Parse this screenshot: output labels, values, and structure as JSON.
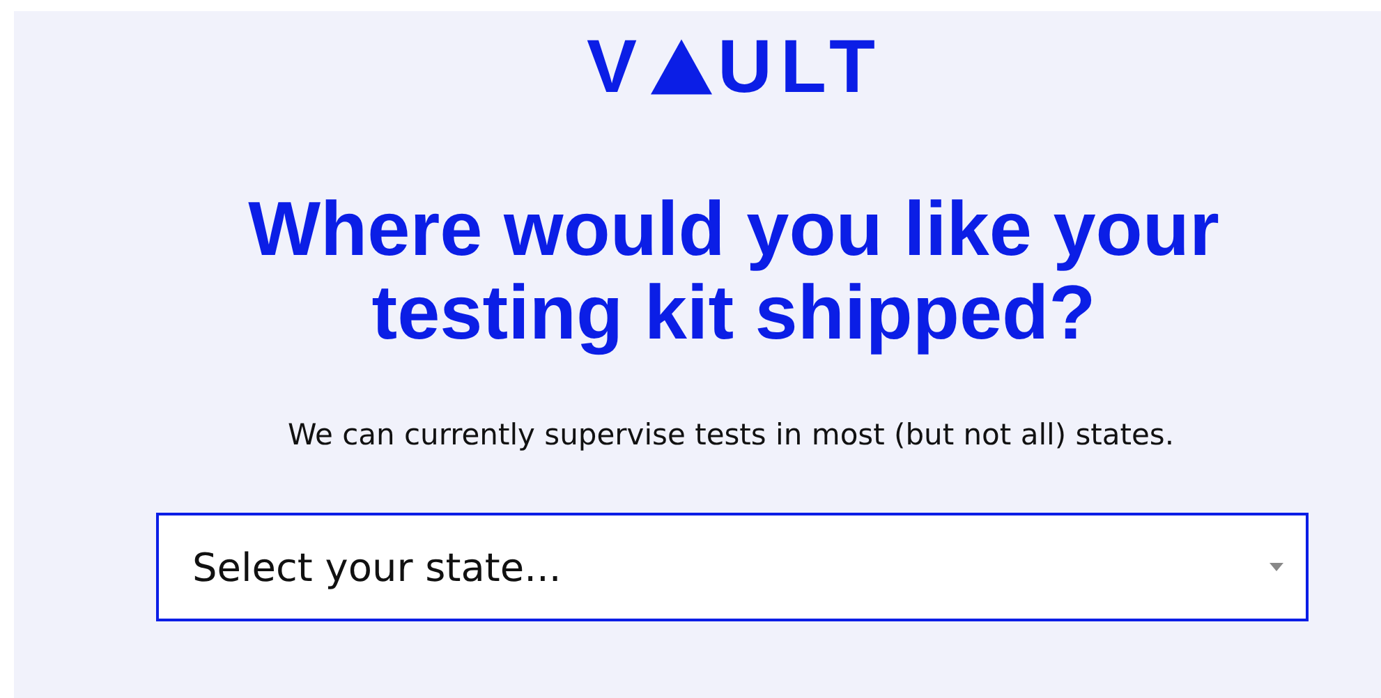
{
  "logo": {
    "before": "V",
    "after": "ULT"
  },
  "heading": "Where would you like your testing kit shipped?",
  "subtitle": "We can currently supervise tests in most (but not all) states.",
  "state_select": {
    "placeholder": "Select your state..."
  }
}
